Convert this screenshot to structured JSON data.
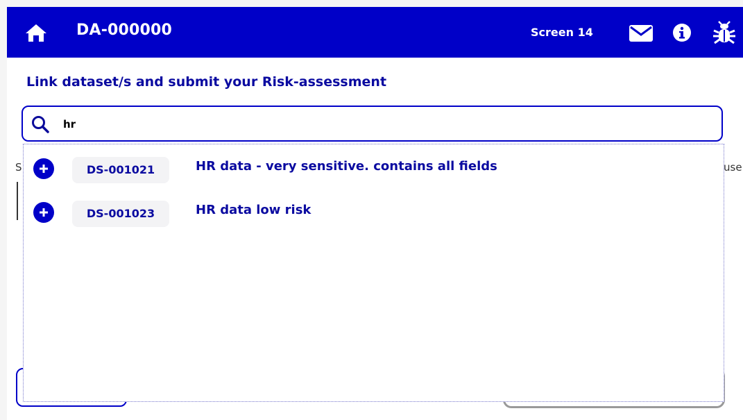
{
  "header": {
    "app_title": "DA-000000",
    "screen_label": "Screen 14",
    "bg_color": "#0000c8",
    "icons": [
      "home-icon",
      "mail-icon",
      "info-icon",
      "bug-icon"
    ]
  },
  "main": {
    "heading": "Link dataset/s and submit your Risk-assessment",
    "search": {
      "value": "hr",
      "placeholder": ""
    },
    "background_fragments": {
      "left_letter": "S",
      "right_text": "use"
    }
  },
  "results": [
    {
      "id": "DS-001021",
      "description": "HR data  - very sensitive. contains all fields"
    },
    {
      "id": "DS-001023",
      "description": "HR data low risk"
    }
  ],
  "colors": {
    "accent": "#0000c8",
    "text_accent": "#0a0aa0"
  }
}
